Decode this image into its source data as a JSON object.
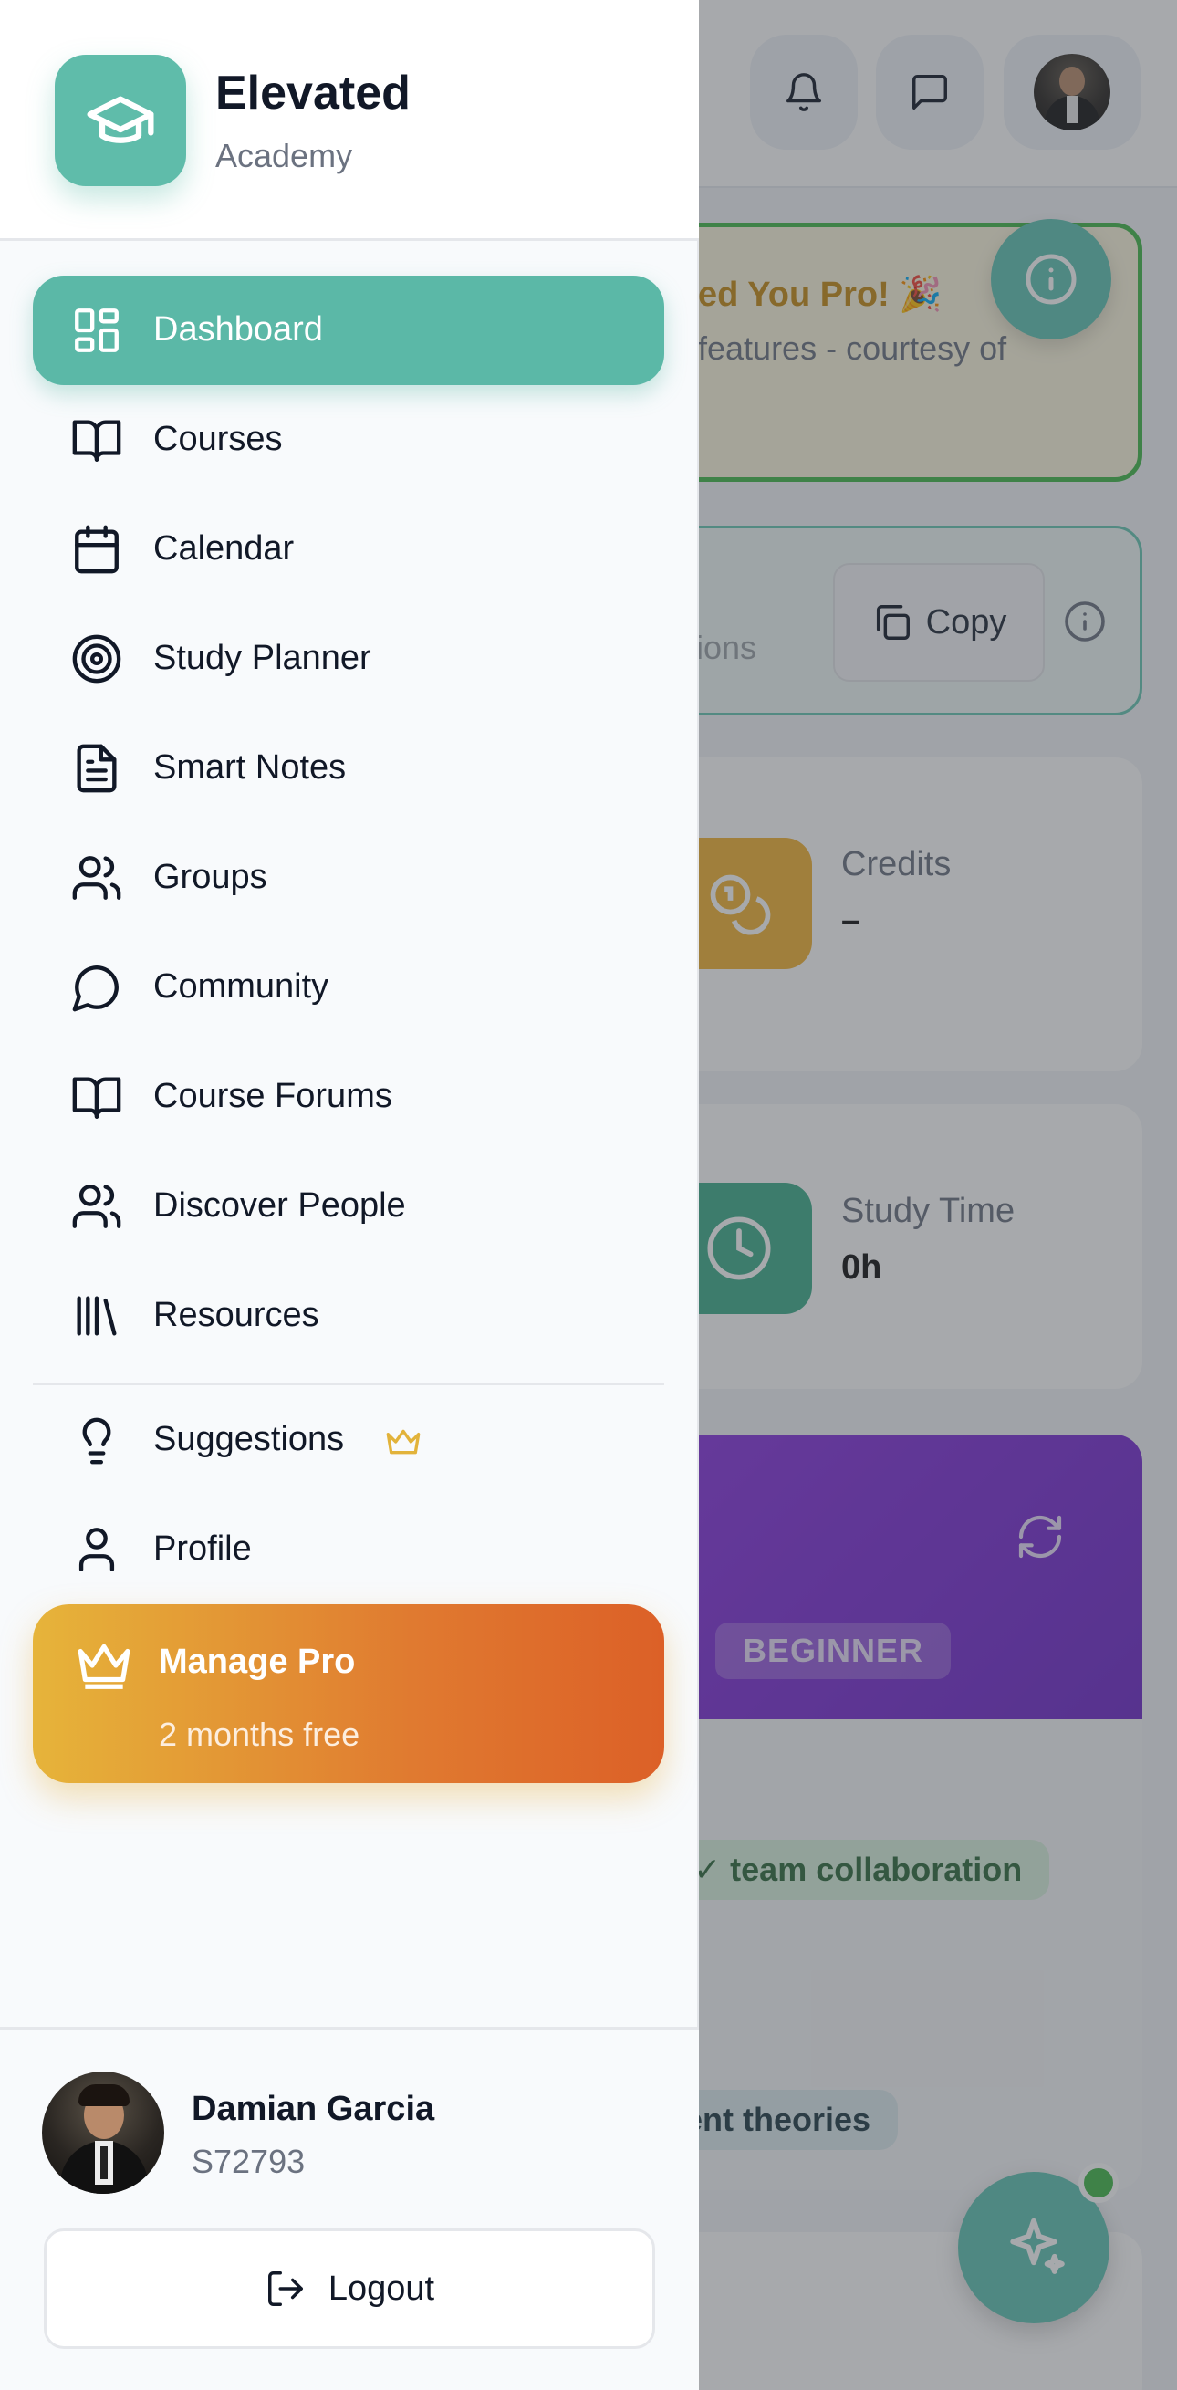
{
  "brand": {
    "name": "Elevated",
    "subtitle": "Academy",
    "logo_icon": "graduation-cap-icon",
    "accent": "#5bb8a7"
  },
  "nav": {
    "items": [
      {
        "label": "Dashboard",
        "icon": "dashboard-icon",
        "active": true
      },
      {
        "label": "Courses",
        "icon": "book-open-icon"
      },
      {
        "label": "Calendar",
        "icon": "calendar-icon"
      },
      {
        "label": "Study Planner",
        "icon": "target-icon"
      },
      {
        "label": "Smart Notes",
        "icon": "file-text-icon"
      },
      {
        "label": "Groups",
        "icon": "users-icon"
      },
      {
        "label": "Community",
        "icon": "message-circle-icon"
      },
      {
        "label": "Course Forums",
        "icon": "book-open-icon"
      },
      {
        "label": "Discover People",
        "icon": "users-icon"
      },
      {
        "label": "Resources",
        "icon": "library-icon"
      }
    ],
    "secondary": [
      {
        "label": "Suggestions",
        "icon": "lightbulb-icon",
        "badge_icon": "crown-icon"
      },
      {
        "label": "Profile",
        "icon": "user-icon"
      }
    ]
  },
  "pro": {
    "title": "Manage Pro",
    "subtitle": "2 months free",
    "icon": "crown-icon"
  },
  "user": {
    "name": "Damian Garcia",
    "id": "S72793"
  },
  "logout": {
    "label": "Logout",
    "icon": "logout-icon"
  },
  "background": {
    "header_icons": [
      "bell-icon",
      "message-square-icon",
      "avatar"
    ],
    "promo": {
      "line1": "ed You Pro! 🎉",
      "line2": "features - courtesy of"
    },
    "invite": {
      "text": "ions",
      "copy_label": "Copy"
    },
    "stats": [
      {
        "label": "Credits",
        "value": "–",
        "icon": "coins-icon",
        "color": "#f2b233"
      },
      {
        "label": "Study Time",
        "value": "0h",
        "icon": "clock-icon",
        "color": "#3fae8a"
      }
    ],
    "level": {
      "badge": "BEGINNER",
      "header_color": "#7c3aed"
    },
    "chips": [
      "team collaboration",
      "ent theories"
    ]
  }
}
